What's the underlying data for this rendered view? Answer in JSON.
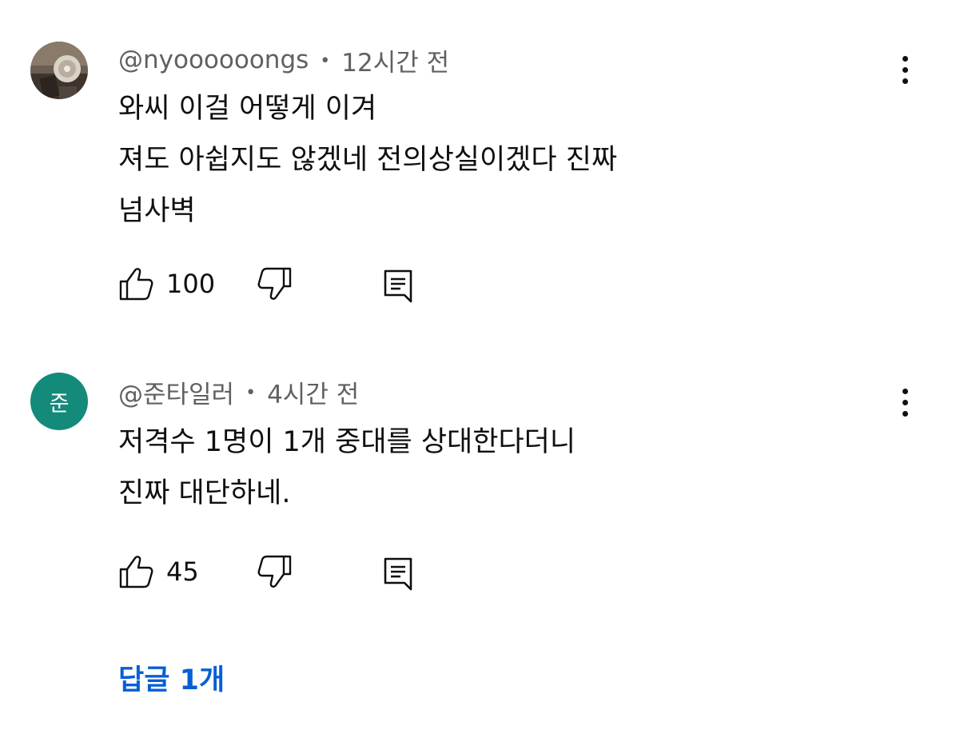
{
  "comments": [
    {
      "author": "@nyoooooongs",
      "time": "12시간 전",
      "meta_separator": "•",
      "lines": [
        "와씨 이걸 어떻게 이겨",
        "져도 아쉽지도 않겠네 전의상실이겠다 진짜",
        "넘사벽"
      ],
      "likes": "100",
      "avatar": {
        "type": "photo"
      }
    },
    {
      "author": "@준타일러",
      "time": "4시간 전",
      "meta_separator": "•",
      "lines": [
        "저격수 1명이 1개 중대를 상대한다더니",
        "진짜 대단하네."
      ],
      "likes": "45",
      "avatar": {
        "type": "letter",
        "letter": "준",
        "color": "#148a7a"
      }
    }
  ],
  "replies_label": "답글 1개",
  "colors": {
    "accent_link": "#065fd4",
    "meta_text": "#606060",
    "body_text": "#0f0f0f"
  },
  "icons": {
    "like": "thumb-up-icon",
    "dislike": "thumb-down-icon",
    "reply": "comment-reply-icon",
    "more": "more-vertical-icon"
  }
}
